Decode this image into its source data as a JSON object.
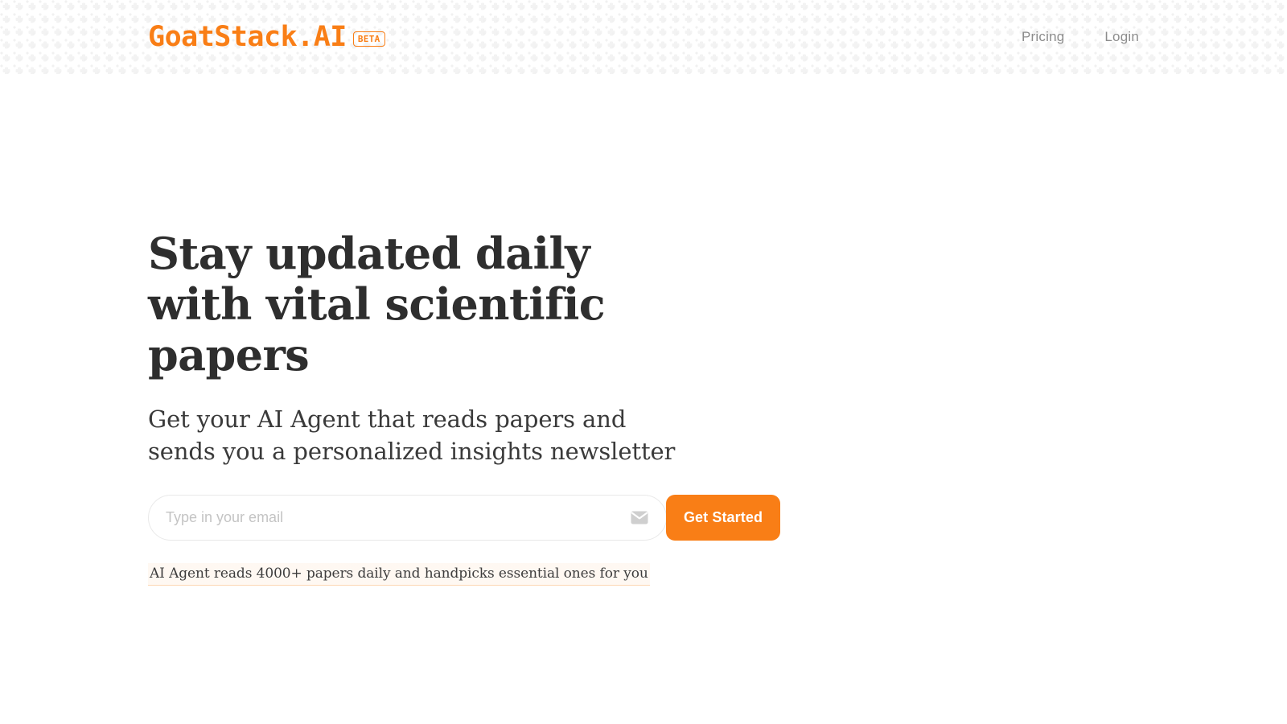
{
  "brand": {
    "wordmark": "GoatStack.AI",
    "badge": "BETA",
    "accent_color": "#f97e16"
  },
  "nav": {
    "links": [
      {
        "label": "Pricing"
      },
      {
        "label": "Login"
      }
    ]
  },
  "hero": {
    "title": "Stay updated daily with vital scientific papers",
    "subtitle": "Get your AI Agent that reads papers and sends you a personalized insights newsletter",
    "tagline": "AI Agent reads 4000+ papers daily and handpicks essential ones for you",
    "title_color": "#2e2e2e"
  },
  "signup": {
    "email_placeholder": "Type in your email",
    "email_value": "",
    "icon": "envelope-icon",
    "submit_label": "Get Started",
    "submit_color": "#f97e16"
  },
  "page": {
    "background": "#ffffff",
    "header_pattern_color": "#f1f1f1"
  }
}
